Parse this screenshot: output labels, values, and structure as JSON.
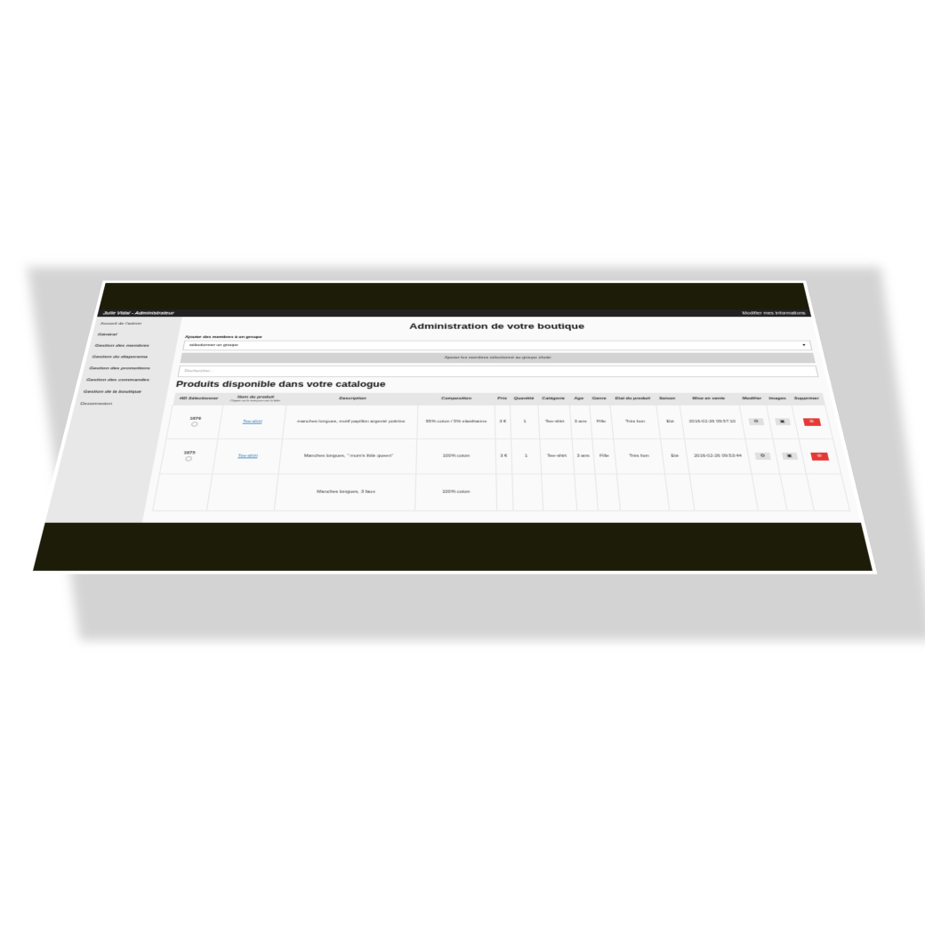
{
  "navbar": {
    "user": "Julie Vidal - Administrateur",
    "right": "Modifier mes informations"
  },
  "sidebar": {
    "items": [
      {
        "label": "Accueil de l'admin",
        "bold": false
      },
      {
        "label": "Général",
        "bold": true
      },
      {
        "label": "Gestion des membres",
        "bold": true
      },
      {
        "label": "Gestion du diaporama",
        "bold": true
      },
      {
        "label": "Gestion des promotions",
        "bold": true
      },
      {
        "label": "Gestion des commandes",
        "bold": true
      },
      {
        "label": "Gestion de la boutique",
        "bold": true
      },
      {
        "label": "Deconnexion",
        "bold": false
      }
    ]
  },
  "main": {
    "title": "Administration de votre boutique",
    "group_label": "Ajouter des membres à un groupe",
    "group_select": "sélectionner un groupe",
    "add_button": "Ajouter les membres sélectionné au groupe choisi",
    "search_placeholder": "Rechercher...",
    "catalog_title": "Produits disponible dans votre catalogue"
  },
  "table": {
    "headers": [
      "#ID Sélectionner",
      "Nom du produit",
      "Description",
      "Composition",
      "Prix",
      "Quantité",
      "Catégorie",
      "Age",
      "Genre",
      "Etat du produit",
      "Saison",
      "Mise en vente",
      "Modifier",
      "Images",
      "Supprimer"
    ],
    "name_sub": "Cliquez sur le nom pour voir la fiche",
    "rows": [
      {
        "id": "1676",
        "name": "Tee-shirt",
        "description": "manches longues, motif papillon argenté poitrine",
        "composition": "95% coton / 5% elasthanne",
        "price": "3 €",
        "qty": "1",
        "category": "Tee-shirt",
        "age": "3 ans",
        "gender": "Fille",
        "state": "Très bon",
        "season": "Eté",
        "date": "2016-02-26 09:57:10"
      },
      {
        "id": "1675",
        "name": "Tee-shirt",
        "description": "Manches longues, \" mum's little queen\"",
        "composition": "100% coton",
        "price": "3 €",
        "qty": "1",
        "category": "Tee-shirt",
        "age": "3 ans",
        "gender": "Fille",
        "state": "Très bon",
        "season": "Eté",
        "date": "2016-02-26 09:53:44"
      },
      {
        "id": "",
        "name": "",
        "description": "Manches longues, 3 faux",
        "composition": "100% coton",
        "price": "",
        "qty": "",
        "category": "",
        "age": "",
        "gender": "",
        "state": "",
        "season": "",
        "date": ""
      }
    ]
  },
  "icons": {
    "edit": "gear-icon",
    "images": "image-icon",
    "delete": "delete-icon"
  },
  "colors": {
    "band": "#1c1c08",
    "delete": "#e53935",
    "link": "#2a7ab8"
  }
}
